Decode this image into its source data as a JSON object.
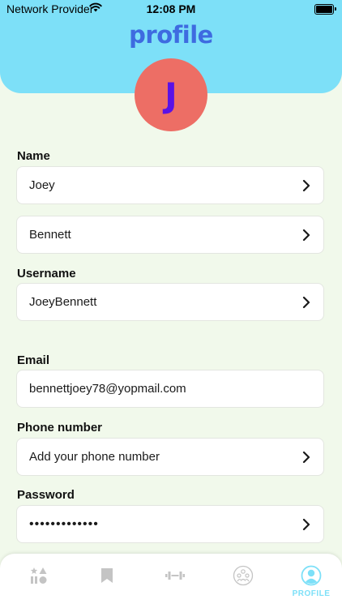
{
  "status_bar": {
    "carrier": "Network Provider",
    "time": "12:08 PM"
  },
  "header": {
    "logo_text": "profile",
    "avatar_initial": "J"
  },
  "form": {
    "name_label": "Name",
    "first_name": "Joey",
    "last_name": "Bennett",
    "username_label": "Username",
    "username": "JoeyBennett",
    "email_label": "Email",
    "email": "bennettjoey78@yopmail.com",
    "phone_label": "Phone number",
    "phone_placeholder": "Add your phone number",
    "password_label": "Password",
    "password_masked": "•••••••••••••"
  },
  "tab_bar": {
    "tabs": [
      {
        "icon": "shapes-icon",
        "label": "",
        "active": false
      },
      {
        "icon": "bookmark-icon",
        "label": "",
        "active": false
      },
      {
        "icon": "dumbbell-icon",
        "label": "",
        "active": false
      },
      {
        "icon": "community-icon",
        "label": "",
        "active": false
      },
      {
        "icon": "profile-icon",
        "label": "PROFILE",
        "active": true
      }
    ]
  },
  "colors": {
    "header_bg": "#7de0f8",
    "page_bg": "#f1f9eb",
    "avatar_bg": "#ed6e65",
    "avatar_text": "#5a12e6",
    "logo": "#3e6be0",
    "active_tab": "#7de0f8",
    "inactive_tab": "#c4c4c4"
  }
}
